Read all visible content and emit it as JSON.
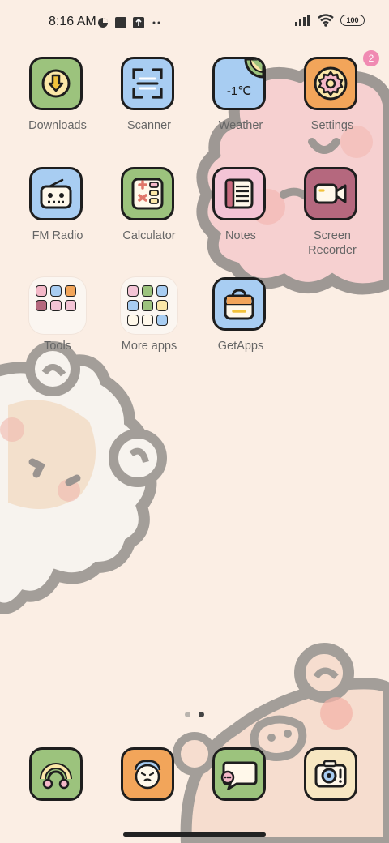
{
  "status_bar": {
    "time": "8:16 AM",
    "battery": "100",
    "icons_left": [
      "pie-status-icon",
      "square-notification-icon",
      "upload-notification-icon",
      "more-dots-icon"
    ],
    "icons_right": [
      "signal-icon",
      "wifi-icon",
      "battery-icon"
    ]
  },
  "apps": [
    {
      "id": "downloads",
      "label": "Downloads",
      "color": "#9cc37d",
      "icon": "download-arrow-icon"
    },
    {
      "id": "scanner",
      "label": "Scanner",
      "color": "#a8cdf2",
      "icon": "scan-frame-icon"
    },
    {
      "id": "weather",
      "label": "Weather",
      "color": "#a8cdf2",
      "icon": "weather-icon",
      "text": "-1℃"
    },
    {
      "id": "settings",
      "label": "Settings",
      "color": "#f2a55a",
      "icon": "gear-icon",
      "badge": "2"
    },
    {
      "id": "fm-radio",
      "label": "FM Radio",
      "color": "#a8cdf2",
      "icon": "radio-icon"
    },
    {
      "id": "calculator",
      "label": "Calculator",
      "color": "#9cc37d",
      "icon": "calculator-icon"
    },
    {
      "id": "notes",
      "label": "Notes",
      "color": "#f4c4d6",
      "icon": "notes-icon"
    },
    {
      "id": "screen-recorder",
      "label": "Screen\nRecorder",
      "color": "#b5687e",
      "icon": "video-camera-icon"
    }
  ],
  "folders": [
    {
      "id": "tools",
      "label": "Tools"
    },
    {
      "id": "more-apps",
      "label": "More apps"
    }
  ],
  "getapps": {
    "label": "GetApps",
    "color": "#a8cdf2",
    "icon": "shopping-bag-icon"
  },
  "dock": [
    {
      "id": "phone",
      "color": "#9cc37d",
      "icon": "phone-icon"
    },
    {
      "id": "mascot",
      "color": "#f2a55a",
      "icon": "face-mascot-icon"
    },
    {
      "id": "messaging",
      "color": "#9cc37d",
      "icon": "chat-bubble-icon"
    },
    {
      "id": "camera",
      "color": "#f7e7c2",
      "icon": "camera-icon"
    }
  ],
  "page_indicator": {
    "pages": 2,
    "current": 2
  }
}
